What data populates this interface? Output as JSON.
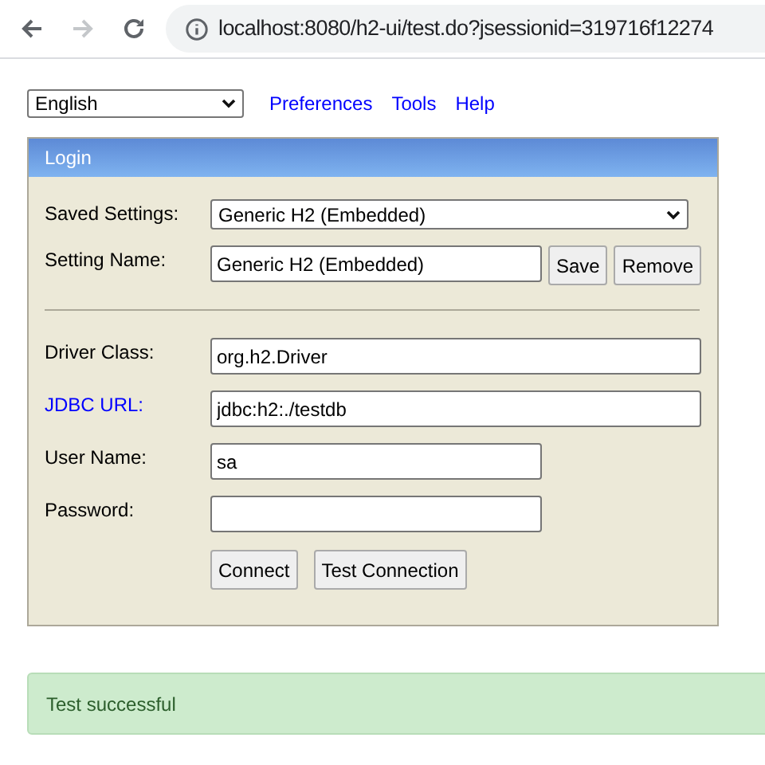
{
  "browser": {
    "url": "localhost:8080/h2-ui/test.do?jsessionid=319716f12274"
  },
  "toolbar": {
    "language": "English",
    "links": [
      "Preferences",
      "Tools",
      "Help"
    ]
  },
  "login": {
    "title": "Login",
    "saved_settings": {
      "label": "Saved Settings:",
      "value": "Generic H2 (Embedded)"
    },
    "setting_name": {
      "label": "Setting Name:",
      "value": "Generic H2 (Embedded)",
      "buttons": [
        "Save",
        "Remove"
      ]
    },
    "fields": [
      {
        "label": "Driver Class:",
        "kind": "text",
        "value": "org.h2.Driver",
        "wide": true
      },
      {
        "label": "JDBC URL:",
        "kind": "link",
        "value": "jdbc:h2:./testdb",
        "wide": true
      },
      {
        "label": "User Name:",
        "kind": "text",
        "value": "sa",
        "wide": false
      },
      {
        "label": "Password:",
        "kind": "text",
        "wide": false
      }
    ],
    "buttons": [
      "Connect",
      "Test Connection"
    ]
  },
  "message": "Test successful"
}
